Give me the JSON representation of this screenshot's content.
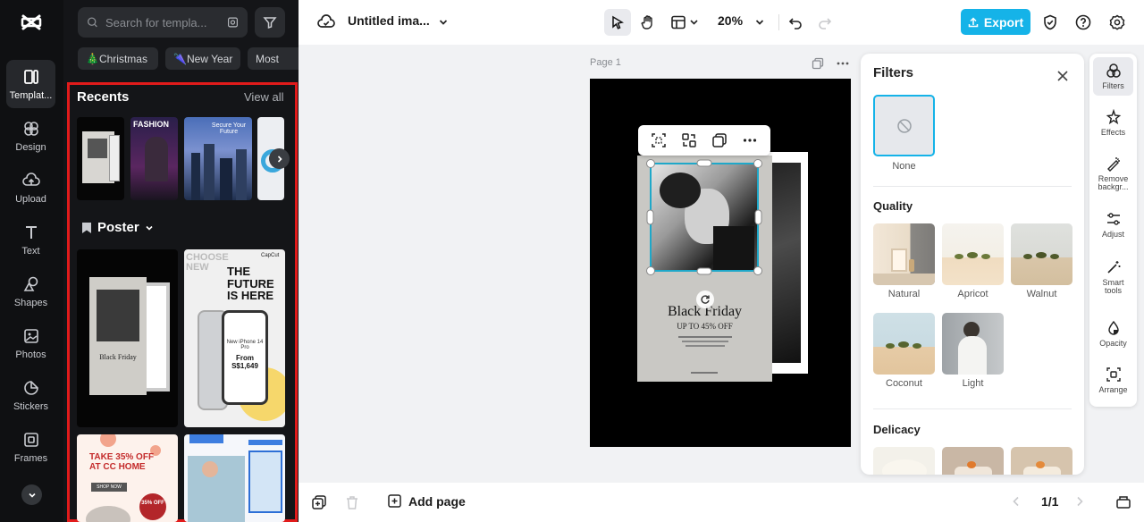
{
  "rail": {
    "items": [
      {
        "label": "Templat..."
      },
      {
        "label": "Design"
      },
      {
        "label": "Upload"
      },
      {
        "label": "Text"
      },
      {
        "label": "Shapes"
      },
      {
        "label": "Photos"
      },
      {
        "label": "Stickers"
      },
      {
        "label": "Frames"
      }
    ]
  },
  "panel": {
    "search_placeholder": "Search for templa...",
    "chips": [
      "🎄Christmas",
      "🌂New Year",
      "Most"
    ],
    "recents_title": "Recents",
    "view_all": "View all",
    "poster_title": "Poster",
    "thumb_texts": {
      "fashion": "FASHION",
      "secure": "Secure Your Future",
      "choose": "CHOOSE NEW",
      "future": "THE FUTURE IS HERE",
      "phone_model": "New iPhone 14 Pro",
      "phone_from": "From",
      "phone_price": "S$1,649",
      "capcut": "CapCut",
      "sale_a": "TAKE 35% OFF",
      "sale_b": "AT CC HOME",
      "shop_now": "SHOP NOW",
      "badge": "35% OFF",
      "black_friday": "Black Friday"
    }
  },
  "topbar": {
    "doc_title": "Untitled ima...",
    "zoom": "20%",
    "export": "Export"
  },
  "canvas": {
    "page_label": "Page 1",
    "poster": {
      "title": "Black Friday",
      "subtitle": "UP TO 45% OFF"
    }
  },
  "filters": {
    "title": "Filters",
    "none_label": "None",
    "quality_title": "Quality",
    "quality": [
      "Natural",
      "Apricot",
      "Walnut",
      "Coconut",
      "Light"
    ],
    "delicacy_title": "Delicacy"
  },
  "right_rail": {
    "items": [
      "Filters",
      "Effects",
      "Remove backgr...",
      "Adjust",
      "Smart tools",
      "Opacity",
      "Arrange"
    ]
  },
  "bottombar": {
    "add_page": "Add page",
    "pager": "1/1"
  },
  "colors": {
    "accent": "#15b3e8",
    "selection": "#e11b1b",
    "selection_box": "#1fa8c9"
  }
}
